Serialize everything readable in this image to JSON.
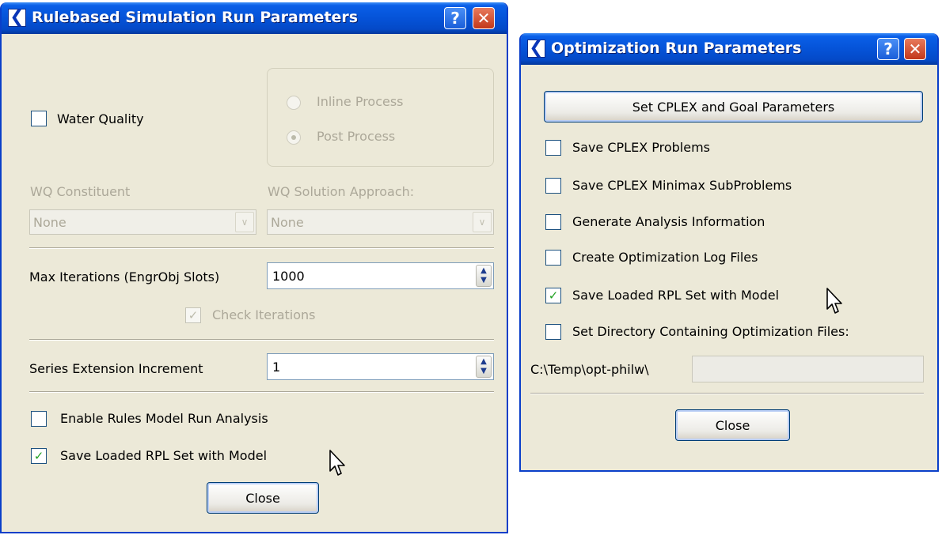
{
  "rulebased": {
    "title": "Rulebased Simulation Run Parameters",
    "water_quality_label": "Water Quality",
    "water_quality_checked": false,
    "process_options": [
      {
        "label": "Inline Process",
        "selected": false
      },
      {
        "label": "Post Process",
        "selected": true
      }
    ],
    "wq_constituent_label": "WQ Constituent",
    "wq_constituent_value": "None",
    "wq_solution_label": "WQ Solution Approach:",
    "wq_solution_value": "None",
    "max_iterations_label": "Max Iterations  (EngrObj Slots)",
    "max_iterations_value": "1000",
    "check_iterations_label": "Check Iterations",
    "check_iterations_checked": true,
    "series_extension_label": "Series Extension Increment",
    "series_extension_value": "1",
    "enable_rules_analysis_label": "Enable Rules Model Run Analysis",
    "enable_rules_analysis_checked": false,
    "save_loaded_rpl_label": "Save Loaded RPL Set with Model",
    "save_loaded_rpl_checked": true,
    "close_label": "Close"
  },
  "optimization": {
    "title": "Optimization Run Parameters",
    "set_cplex_label": "Set CPLEX and Goal Parameters",
    "options": [
      {
        "label": "Save CPLEX Problems",
        "checked": false
      },
      {
        "label": "Save CPLEX Minimax SubProblems",
        "checked": false
      },
      {
        "label": "Generate Analysis Information",
        "checked": false
      },
      {
        "label": "Create Optimization Log Files",
        "checked": false
      },
      {
        "label": "Save Loaded RPL Set with Model",
        "checked": true
      },
      {
        "label": "Set Directory Containing Optimization Files:",
        "checked": false
      }
    ],
    "directory_label": "C:\\Temp\\opt-philw\\",
    "directory_value": "",
    "close_label": "Close"
  },
  "icons": {
    "app": "riverware-logo-icon",
    "help": "help-icon",
    "close": "close-icon",
    "check": "checkmark-icon",
    "cursor": "mouse-pointer-icon"
  },
  "colors": {
    "titlebar": "#0553d8",
    "window_bg": "#ece9d8",
    "close_button": "#c2381b",
    "check_green": "#21a121"
  }
}
